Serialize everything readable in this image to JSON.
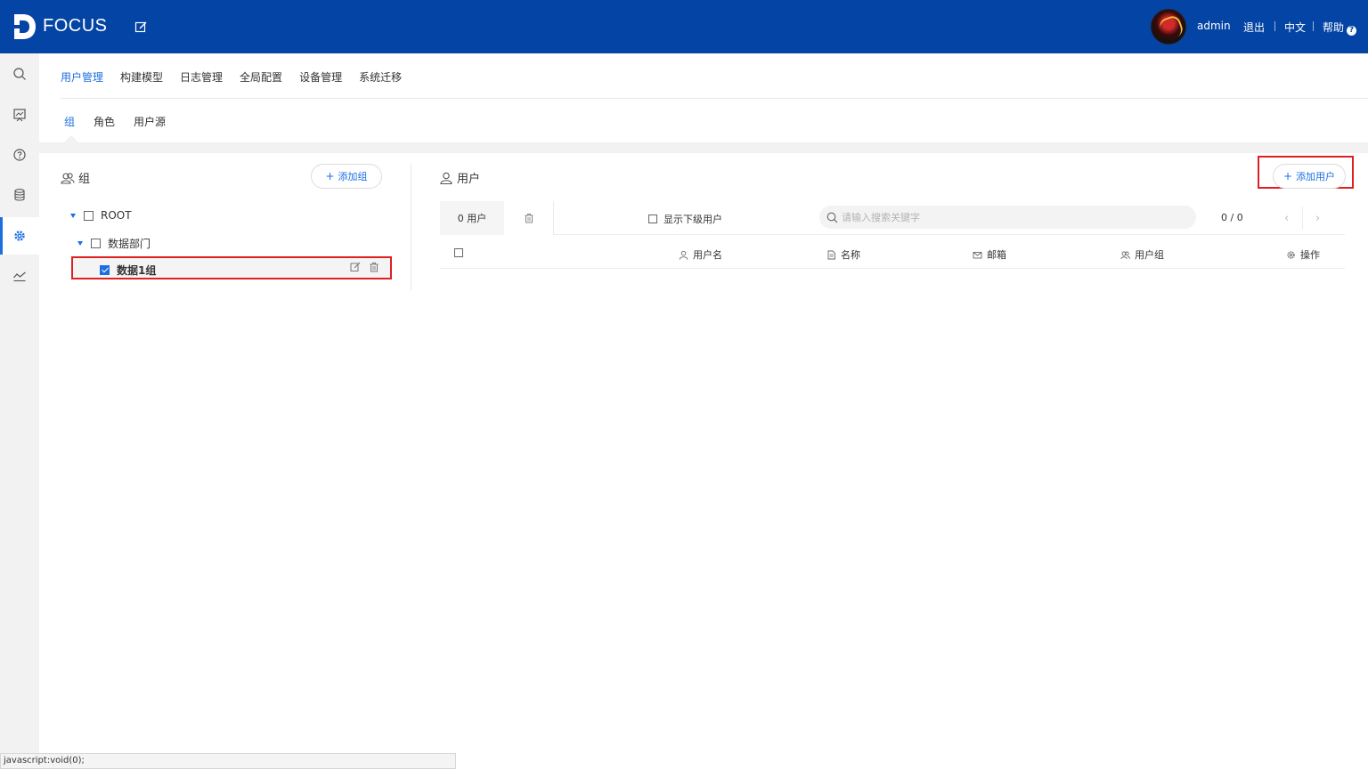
{
  "header": {
    "brand": "FOCUS",
    "username": "admin",
    "logout": "退出",
    "language": "中文",
    "help": "帮助",
    "help_icon_glyph": "?"
  },
  "rail": {
    "icons": [
      "search-icon",
      "dashboard-icon",
      "help-icon",
      "database-icon",
      "gear-icon",
      "chart-line-icon"
    ],
    "active": "gear-icon"
  },
  "nav": {
    "tabs": [
      "用户管理",
      "构建模型",
      "日志管理",
      "全局配置",
      "设备管理",
      "系统迁移"
    ],
    "active_tab": "用户管理"
  },
  "subnav": {
    "tabs": [
      "组",
      "角色",
      "用户源"
    ],
    "active_tab": "组"
  },
  "groups": {
    "title": "组",
    "add_label": "添加组",
    "add_plus": "+",
    "tree": {
      "root": "ROOT",
      "dept": "数据部门",
      "group1": "数据1组"
    }
  },
  "users": {
    "title": "用户",
    "add_label": "添加用户",
    "add_plus": "+",
    "count_label": "0 用户",
    "show_sub_label": "显示下级用户",
    "search_placeholder": "请输入搜索关键字",
    "pager": "0 / 0",
    "prev": "‹",
    "next": "›",
    "columns": [
      "用户名",
      "名称",
      "邮箱",
      "用户组",
      "操作"
    ]
  },
  "status_bar": "javascript:void(0);",
  "colors": {
    "header_bg": "#0444a5",
    "accent": "#1d6fe0",
    "highlight_border": "#e02020"
  }
}
